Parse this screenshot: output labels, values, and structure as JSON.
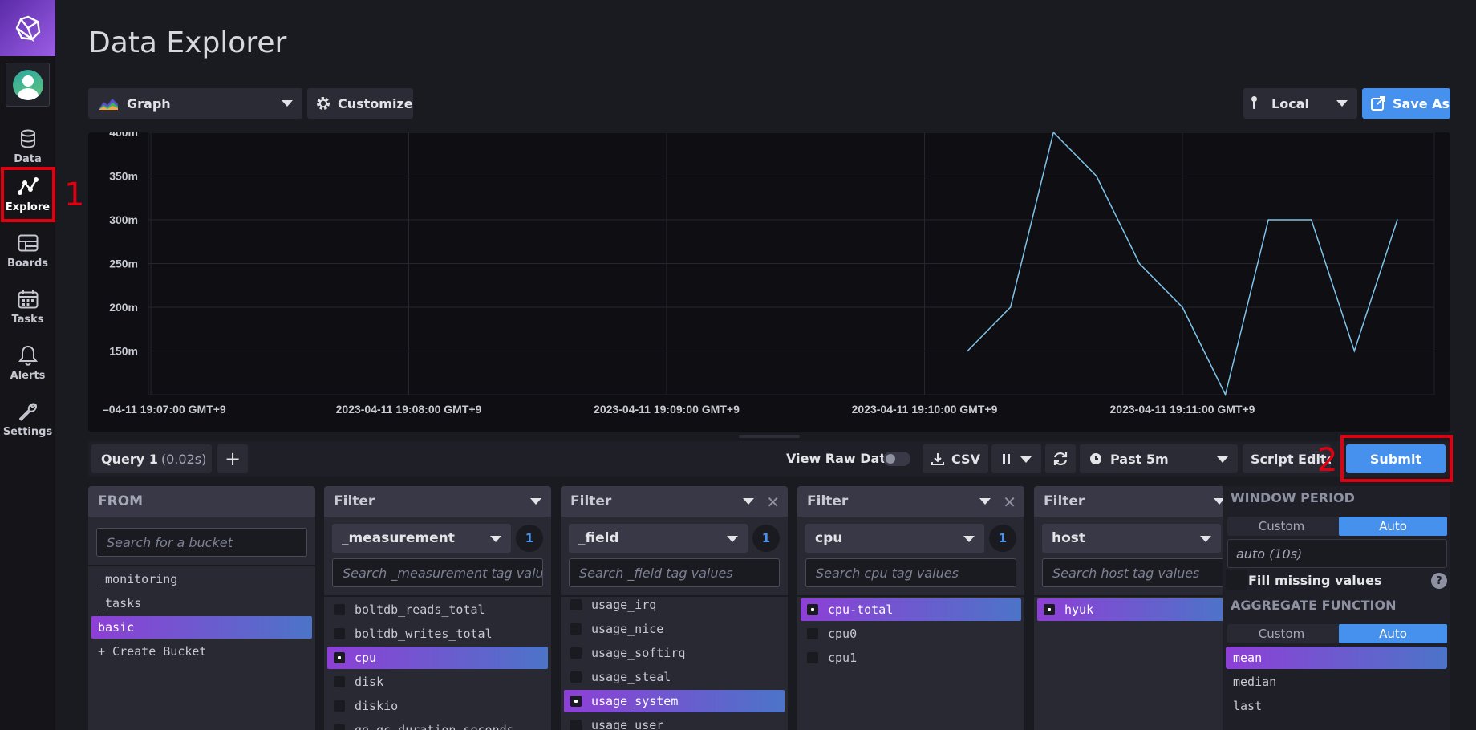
{
  "page": {
    "title": "Data Explorer"
  },
  "nav": {
    "items": [
      {
        "label": "Data",
        "icon": "database-icon"
      },
      {
        "label": "Explore",
        "icon": "explore-icon"
      },
      {
        "label": "Boards",
        "icon": "dashboards-icon"
      },
      {
        "label": "Tasks",
        "icon": "calendar-icon"
      },
      {
        "label": "Alerts",
        "icon": "bell-icon"
      },
      {
        "label": "Settings",
        "icon": "wrench-icon"
      }
    ],
    "active": "Explore"
  },
  "annotations": {
    "first": "1",
    "second": "2"
  },
  "toolbar": {
    "viz_type": "Graph",
    "customize_label": "Customize",
    "timezone": "Local",
    "save_as_label": "Save As"
  },
  "chart_data": {
    "type": "line",
    "x_tick_labels": [
      "–04-11 19:07:00 GMT+9",
      "2023-04-11 19:08:00 GMT+9",
      "2023-04-11 19:09:00 GMT+9",
      "2023-04-11 19:10:00 GMT+9",
      "2023-04-11 19:11:00 GMT+9"
    ],
    "y_tick_labels": [
      "400m",
      "350m",
      "300m",
      "250m",
      "200m",
      "150m"
    ],
    "y_ticks": [
      0.4,
      0.35,
      0.3,
      0.25,
      0.2,
      0.15
    ],
    "ylim": [
      0.1,
      0.4
    ],
    "x_seconds": [
      190,
      200,
      210,
      220,
      230,
      240,
      250,
      260,
      270,
      280,
      290
    ],
    "values": [
      0.15,
      0.2,
      0.4,
      0.35,
      0.25,
      0.2,
      0.1,
      0.3,
      0.3,
      0.15,
      0.3
    ],
    "color": "#7ec3e8",
    "grid": true
  },
  "query": {
    "tab_label": "Query 1",
    "tab_time": "(0.02s)",
    "add_label": "+",
    "view_raw_label": "View Raw Data",
    "csv_label": "CSV",
    "time_range": "Past 5m",
    "script_editor_label": "Script Editor",
    "submit_label": "Submit"
  },
  "from": {
    "header": "FROM",
    "search_placeholder": "Search for a bucket",
    "items": [
      "_monitoring",
      "_tasks",
      "basic",
      "+ Create Bucket"
    ],
    "selected": "basic"
  },
  "filters": [
    {
      "header": "Filter",
      "key": "_measurement",
      "count": "1",
      "search_placeholder": "Search _measurement tag values",
      "items": [
        "boltdb_reads_total",
        "boltdb_writes_total",
        "cpu",
        "disk",
        "diskio",
        "go_gc_duration_seconds"
      ],
      "selected": "cpu"
    },
    {
      "header": "Filter",
      "key": "_field",
      "count": "1",
      "search_placeholder": "Search _field tag values",
      "items": [
        "usage_irq",
        "usage_nice",
        "usage_softirq",
        "usage_steal",
        "usage_system",
        "usage_user"
      ],
      "selected": "usage_system"
    },
    {
      "header": "Filter",
      "key": "cpu",
      "count": "1",
      "search_placeholder": "Search cpu tag values",
      "items": [
        "cpu-total",
        "cpu0",
        "cpu1"
      ],
      "selected": "cpu-total"
    },
    {
      "header": "Filter",
      "key": "host",
      "search_placeholder": "Search host tag values",
      "items": [
        "hyuk"
      ],
      "selected": "hyuk"
    }
  ],
  "window_period": {
    "header": "WINDOW PERIOD",
    "custom_label": "Custom",
    "auto_label": "Auto",
    "value": "auto (10s)",
    "fill_missing_label": "Fill missing values",
    "help_label": "?"
  },
  "aggregate": {
    "header": "AGGREGATE FUNCTION",
    "custom_label": "Custom",
    "auto_label": "Auto",
    "items": [
      "mean",
      "median",
      "last"
    ],
    "selected": "mean"
  }
}
